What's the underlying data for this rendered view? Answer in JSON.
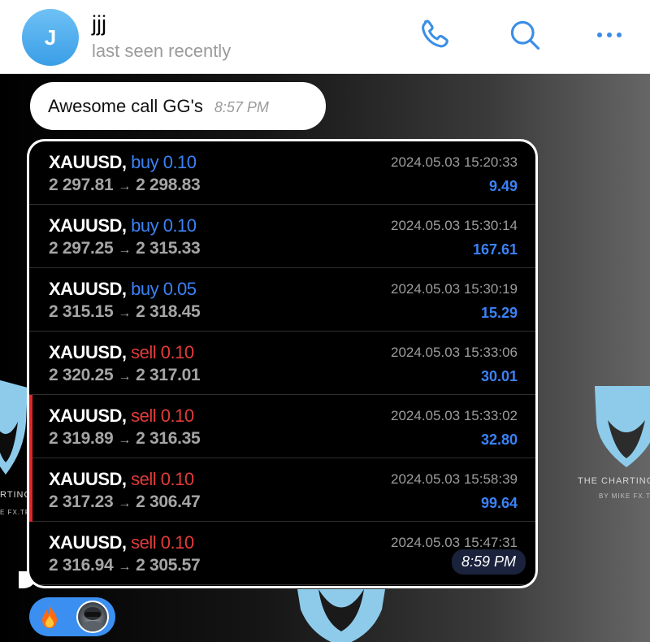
{
  "header": {
    "avatar_initial": "J",
    "chat_name": "jjj",
    "status": "last seen recently",
    "icons": [
      "phone-icon",
      "search-icon",
      "more-icon"
    ]
  },
  "messages": {
    "text_message": {
      "text": "Awesome call GG's",
      "time": "8:57 PM"
    },
    "image_message": {
      "time": "8:59 PM",
      "trades": [
        {
          "symbol": "XAUUSD,",
          "side": "buy",
          "volume": "0.10",
          "open": "2 297.81",
          "close": "2 298.83",
          "datetime": "2024.05.03 15:20:33",
          "profit": "9.49",
          "marked": false
        },
        {
          "symbol": "XAUUSD,",
          "side": "buy",
          "volume": "0.10",
          "open": "2 297.25",
          "close": "2 315.33",
          "datetime": "2024.05.03 15:30:14",
          "profit": "167.61",
          "marked": false
        },
        {
          "symbol": "XAUUSD,",
          "side": "buy",
          "volume": "0.05",
          "open": "2 315.15",
          "close": "2 318.45",
          "datetime": "2024.05.03 15:30:19",
          "profit": "15.29",
          "marked": false
        },
        {
          "symbol": "XAUUSD,",
          "side": "sell",
          "volume": "0.10",
          "open": "2 320.25",
          "close": "2 317.01",
          "datetime": "2024.05.03 15:33:06",
          "profit": "30.01",
          "marked": false
        },
        {
          "symbol": "XAUUSD,",
          "side": "sell",
          "volume": "0.10",
          "open": "2 319.89",
          "close": "2 316.35",
          "datetime": "2024.05.03 15:33:02",
          "profit": "32.80",
          "marked": true
        },
        {
          "symbol": "XAUUSD,",
          "side": "sell",
          "volume": "0.10",
          "open": "2 317.23",
          "close": "2 306.47",
          "datetime": "2024.05.03 15:58:39",
          "profit": "99.64",
          "marked": true
        },
        {
          "symbol": "XAUUSD,",
          "side": "sell",
          "volume": "0.10",
          "open": "2 316.94",
          "close": "2 305.57",
          "datetime": "2024.05.03 15:47:31",
          "profit": "",
          "marked": false
        }
      ]
    },
    "reactions": [
      "fire-emoji",
      "user-avatar"
    ]
  },
  "watermark": {
    "left_title": "RTING S",
    "left_sub": "E FX.TRA",
    "right_title": "THE CHARTING",
    "right_sub": "BY MIKE FX.TR"
  },
  "colors": {
    "accent": "#3b82f6",
    "buy": "#3b82f6",
    "sell": "#e23b3b",
    "header_icon": "#3a8ee6",
    "reaction_bg": "#3b8ff0"
  }
}
